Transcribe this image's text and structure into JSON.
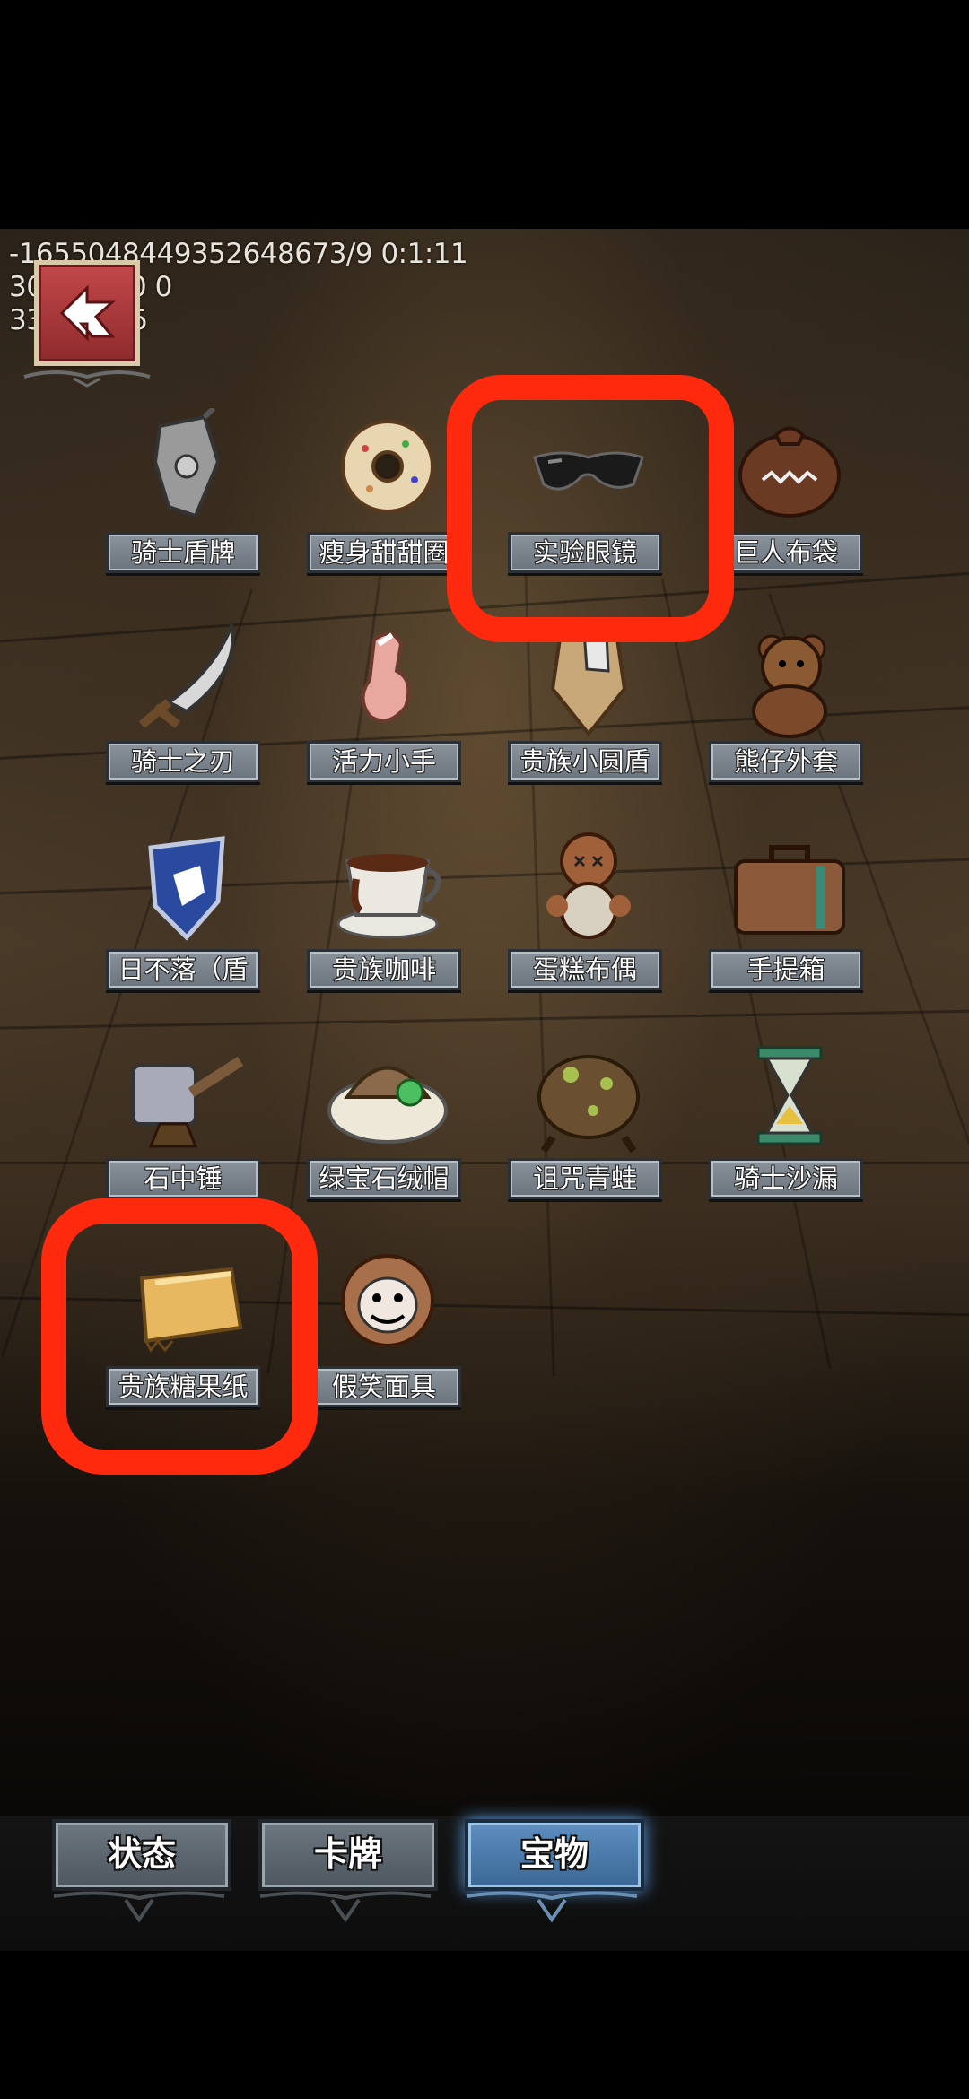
{
  "debug": {
    "line1": "-1655048449352648673/9 0:1:11",
    "line2": "30004 0 0 0",
    "line3": "3383_ 5_5"
  },
  "items": [
    {
      "name": "骑士盾牌",
      "icon": "knight-shield-icon"
    },
    {
      "name": "瘦身甜甜圈",
      "icon": "donut-icon"
    },
    {
      "name": "实验眼镜",
      "icon": "sunglasses-icon"
    },
    {
      "name": "巨人布袋",
      "icon": "sack-icon"
    },
    {
      "name": "骑士之刃",
      "icon": "blade-icon"
    },
    {
      "name": "活力小手",
      "icon": "hand-icon"
    },
    {
      "name": "贵族小圆盾",
      "icon": "round-shield-icon"
    },
    {
      "name": "熊仔外套",
      "icon": "teddy-bear-icon"
    },
    {
      "name": "日不落（盾",
      "icon": "crest-shield-icon"
    },
    {
      "name": "贵族咖啡",
      "icon": "coffee-cup-icon"
    },
    {
      "name": "蛋糕布偶",
      "icon": "voodoo-doll-icon"
    },
    {
      "name": "手提箱",
      "icon": "suitcase-icon"
    },
    {
      "name": "石中锤",
      "icon": "hammer-icon"
    },
    {
      "name": "绿宝石绒帽",
      "icon": "fur-hat-icon"
    },
    {
      "name": "诅咒青蛙",
      "icon": "cursed-frog-icon"
    },
    {
      "name": "骑士沙漏",
      "icon": "hourglass-icon"
    },
    {
      "name": "贵族糖果纸",
      "icon": "candy-wrapper-icon"
    },
    {
      "name": "假笑面具",
      "icon": "smile-mask-icon"
    }
  ],
  "tabs": [
    {
      "label": "状态",
      "active": false
    },
    {
      "label": "卡牌",
      "active": false
    },
    {
      "label": "宝物",
      "active": true
    }
  ],
  "annotations": {
    "color": "#ff2a0e"
  }
}
